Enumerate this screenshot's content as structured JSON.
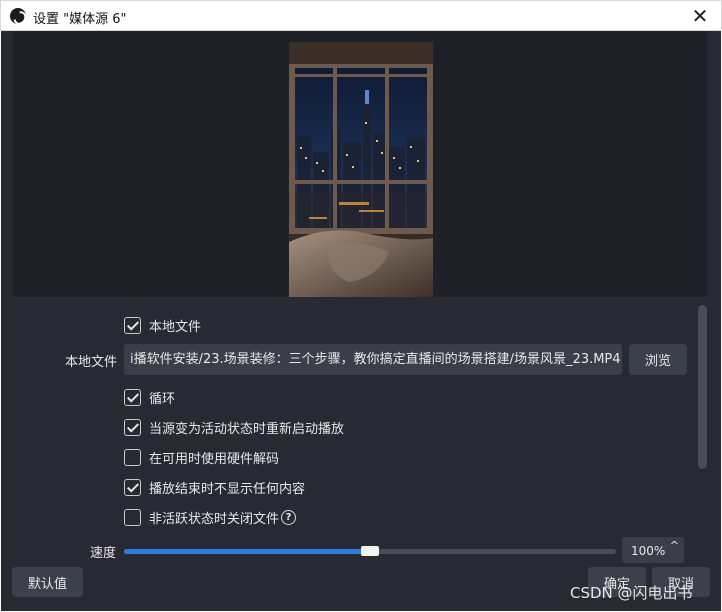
{
  "window": {
    "title": "设置 \"媒体源 6\"",
    "close_symbol": "✕",
    "app_icon": "obs-logo-icon"
  },
  "properties": {
    "local_file_checkbox": {
      "label": "本地文件",
      "checked": true
    },
    "local_file_field": {
      "label": "本地文件",
      "value": "i播软件安装/23.场景装修：三个步骤，教你搞定直播间的场景搭建/场景风景_23.MP4",
      "browse_label": "浏览"
    },
    "options": [
      {
        "label": "循环",
        "checked": true
      },
      {
        "label": "当源变为活动状态时重新启动播放",
        "checked": true
      },
      {
        "label": "在可用时使用硬件解码",
        "checked": false
      },
      {
        "label": "播放结束时不显示任何内容",
        "checked": true
      },
      {
        "label": "非活跃状态时关闭文件",
        "checked": false,
        "help_icon": "help-circle-icon",
        "help_symbol": "?"
      }
    ],
    "speed": {
      "label": "速度",
      "value": "100%",
      "fraction": 0.5,
      "up_symbol": "^"
    }
  },
  "footer": {
    "defaults_label": "默认值",
    "ok_label": "确定",
    "cancel_label": "取消"
  },
  "watermark": "CSDN @闪电出书",
  "colors": {
    "accent": "#2d7de0",
    "panel": "#272a33",
    "input": "#3b3e48"
  }
}
